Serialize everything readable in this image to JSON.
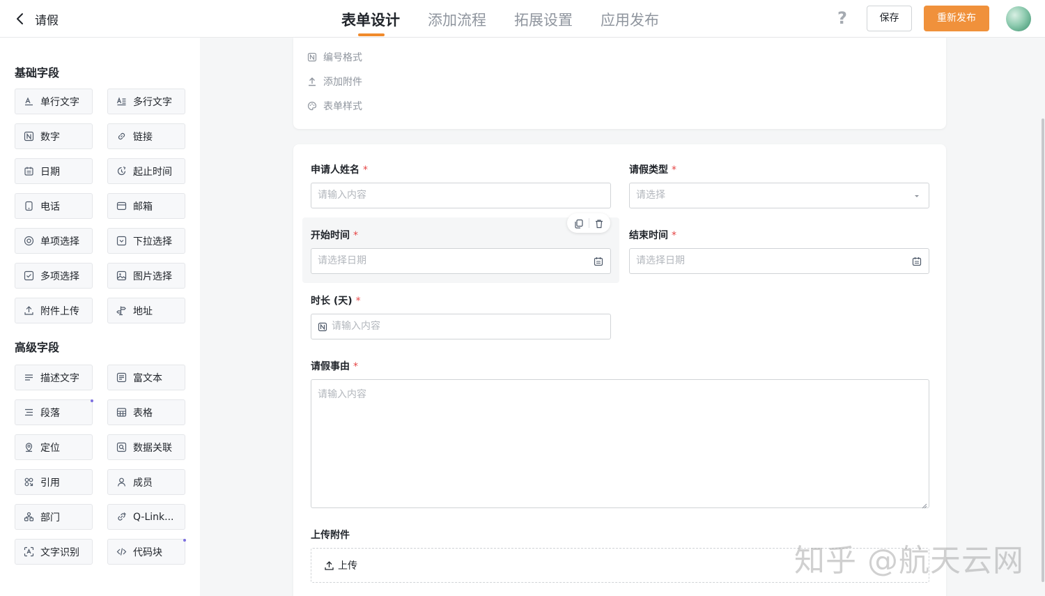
{
  "header": {
    "app_title": "请假",
    "tabs": [
      {
        "label": "表单设计",
        "active": true
      },
      {
        "label": "添加流程",
        "active": false
      },
      {
        "label": "拓展设置",
        "active": false
      },
      {
        "label": "应用发布",
        "active": false
      }
    ],
    "help_label": "?",
    "save_label": "保存",
    "publish_label": "重新发布",
    "accent_color": "#f0913b"
  },
  "sidebar": {
    "basic_title": "基础字段",
    "basic_fields": [
      {
        "label": "单行文字",
        "icon": "single-line-text-icon"
      },
      {
        "label": "多行文字",
        "icon": "multi-line-text-icon"
      },
      {
        "label": "数字",
        "icon": "number-icon"
      },
      {
        "label": "链接",
        "icon": "link-icon"
      },
      {
        "label": "日期",
        "icon": "date-icon"
      },
      {
        "label": "起止时间",
        "icon": "time-range-icon"
      },
      {
        "label": "电话",
        "icon": "phone-icon"
      },
      {
        "label": "邮箱",
        "icon": "email-icon"
      },
      {
        "label": "单项选择",
        "icon": "radio-icon"
      },
      {
        "label": "下拉选择",
        "icon": "dropdown-icon"
      },
      {
        "label": "多项选择",
        "icon": "checkbox-icon"
      },
      {
        "label": "图片选择",
        "icon": "image-select-icon"
      },
      {
        "label": "附件上传",
        "icon": "upload-icon"
      },
      {
        "label": "地址",
        "icon": "address-icon"
      }
    ],
    "advanced_title": "高级字段",
    "advanced_fields": [
      {
        "label": "描述文字",
        "icon": "description-icon"
      },
      {
        "label": "富文本",
        "icon": "rich-text-icon"
      },
      {
        "label": "段落",
        "icon": "paragraph-icon"
      },
      {
        "label": "表格",
        "icon": "table-icon"
      },
      {
        "label": "定位",
        "icon": "location-icon"
      },
      {
        "label": "数据关联",
        "icon": "data-link-icon"
      },
      {
        "label": "引用",
        "icon": "reference-icon"
      },
      {
        "label": "成员",
        "icon": "member-icon"
      },
      {
        "label": "部门",
        "icon": "department-icon"
      },
      {
        "label": "Q-Link...",
        "icon": "qlink-icon"
      },
      {
        "label": "文字识别",
        "icon": "ocr-icon"
      },
      {
        "label": "代码块",
        "icon": "code-icon"
      }
    ]
  },
  "settings": {
    "items": [
      {
        "label": "编号格式",
        "icon": "number-format-icon"
      },
      {
        "label": "添加附件",
        "icon": "attachment-icon"
      },
      {
        "label": "表单样式",
        "icon": "palette-icon"
      }
    ]
  },
  "form": {
    "applicant_label": "申请人姓名",
    "applicant_placeholder": "请输入内容",
    "leave_type_label": "请假类型",
    "leave_type_placeholder": "请选择",
    "start_label": "开始时间",
    "start_placeholder": "请选择日期",
    "end_label": "结束时间",
    "end_placeholder": "请选择日期",
    "duration_label": "时长 (天)",
    "duration_placeholder": "请输入内容",
    "reason_label": "请假事由",
    "reason_placeholder": "请输入内容",
    "attachment_label": "上传附件",
    "upload_label": "上传",
    "required_mark": "*"
  },
  "watermark": "知乎 @航天云网"
}
